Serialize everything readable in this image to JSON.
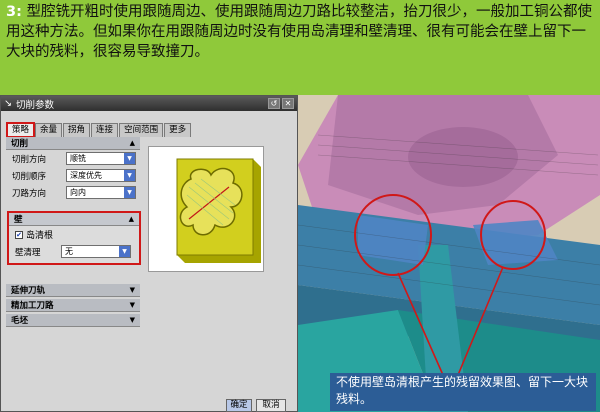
{
  "intro": {
    "number": "3:",
    "text": "型腔铣开粗时使用跟随周边、使用跟随周边刀路比较整洁，抬刀很少，一般加工铜公都使用这种方法。但如果你在用跟随周边时没有使用岛清理和壁清理、很有可能会在壁上留下一大块的残料，很容易导致撞刀。"
  },
  "dialog": {
    "title": "切削参数",
    "tabs": [
      "策略",
      "余量",
      "拐角",
      "连接",
      "空间范围",
      "更多"
    ],
    "sections": {
      "cut": "切削",
      "wall": "壁",
      "extend": "延伸刀轨",
      "finish": "精加工刀路",
      "stock": "毛坯"
    },
    "fields": {
      "cut_direction_label": "切削方向",
      "cut_direction_value": "顺铣",
      "cut_order_label": "切削顺序",
      "cut_order_value": "深度优先",
      "path_direction_label": "刀路方向",
      "path_direction_value": "向内",
      "island_cleanup_label": "岛清根",
      "wall_cleanup_label": "壁清理",
      "wall_cleanup_value": "无"
    },
    "ok_label": "确定",
    "cancel_label": "取消"
  },
  "caption": "不使用壁岛清根产生的残留效果图、留下一大块残料。",
  "colors": {
    "background": "#8fc93a",
    "highlight": "#d01818",
    "caption_bg": "#2c5d96"
  }
}
